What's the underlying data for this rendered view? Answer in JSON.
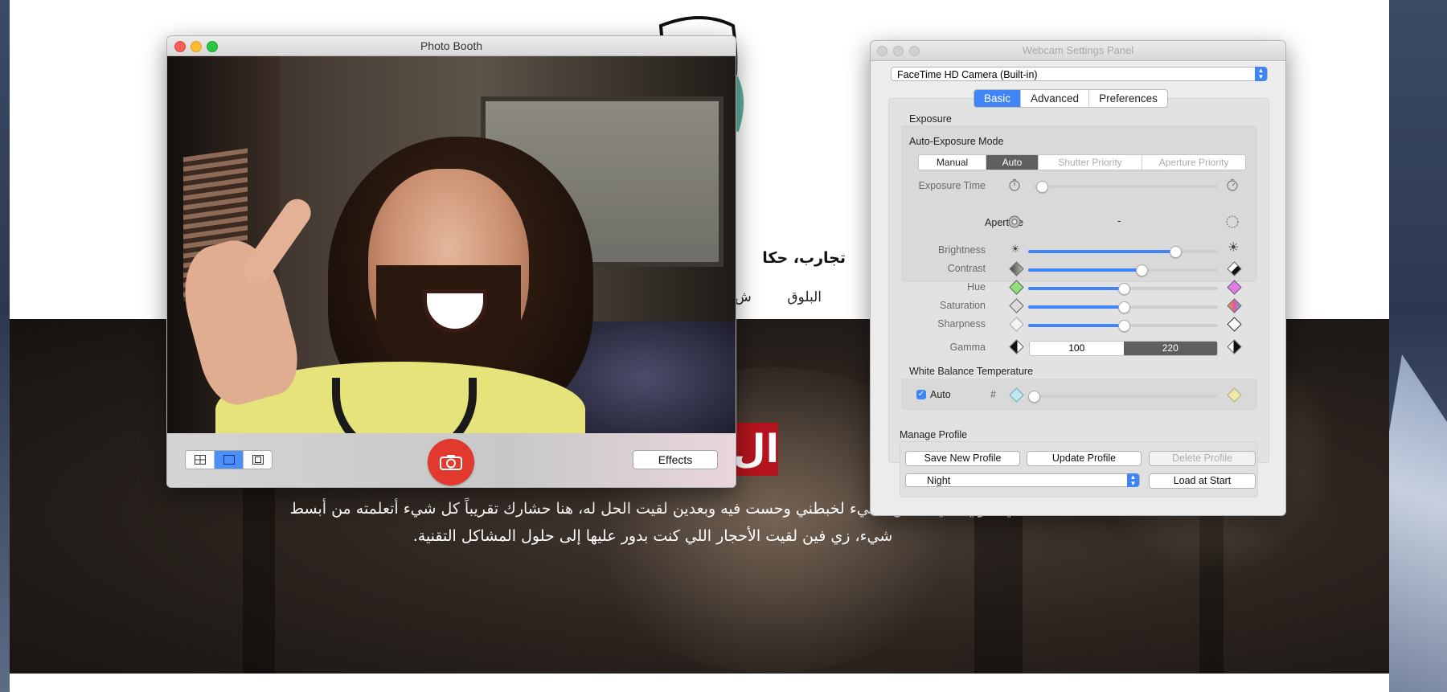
{
  "site": {
    "tagline": "تجارب، حكا",
    "nav_blog": "البلوق",
    "nav_other": "ش",
    "banner_badge": "ال",
    "banner_line1": "ي سوي شيء معين، شيء لخبطني وحست فيه وبعدين لقيت الحل له، هنا حشارك تقريباً كل شيء أتعلمته من أبسط",
    "banner_line2": "شيء، زي فين لقيت الأحجار اللي كنت بدور عليها إلى حلول المشاكل التقنية."
  },
  "photo_booth": {
    "title": "Photo Booth",
    "effects_label": "Effects",
    "view_modes": [
      "grid-icon",
      "single-icon",
      "filmstrip-icon"
    ],
    "selected_view": "single-icon",
    "shutter_icon": "camera-icon",
    "accent": "#e1392d"
  },
  "webcam_panel": {
    "title": "Webcam Settings Panel",
    "camera": "FaceTime HD Camera (Built-in)",
    "tabs": [
      "Basic",
      "Advanced",
      "Preferences"
    ],
    "selected_tab": "Basic",
    "exposure": {
      "heading": "Exposure",
      "mode_heading": "Auto-Exposure Mode",
      "modes": [
        "Manual",
        "Auto",
        "Shutter Priority",
        "Aperture Priority"
      ],
      "selected_mode": "Auto",
      "exposure_time_label": "Exposure Time",
      "exposure_time_value": 0.02,
      "aperture_label": "Aperture",
      "aperture_value": "-"
    },
    "adjustments": [
      {
        "label": "Brightness",
        "value": 0.79
      },
      {
        "label": "Contrast",
        "value": 0.6
      },
      {
        "label": "Hue",
        "value": 0.5
      },
      {
        "label": "Saturation",
        "value": 0.5
      },
      {
        "label": "Sharpness",
        "value": 0.5
      }
    ],
    "gamma": {
      "label": "Gamma",
      "options": [
        "100",
        "220"
      ],
      "selected": "220"
    },
    "white_balance": {
      "heading": "White Balance Temperature",
      "auto_label": "Auto",
      "auto_checked": true,
      "hash": "#",
      "value": 0.0
    },
    "profile": {
      "heading": "Manage Profile",
      "save_label": "Save New Profile",
      "update_label": "Update Profile",
      "delete_label": "Delete Profile",
      "selected_profile": "Night",
      "load_label": "Load at Start"
    },
    "accent": "#3f85f7"
  }
}
